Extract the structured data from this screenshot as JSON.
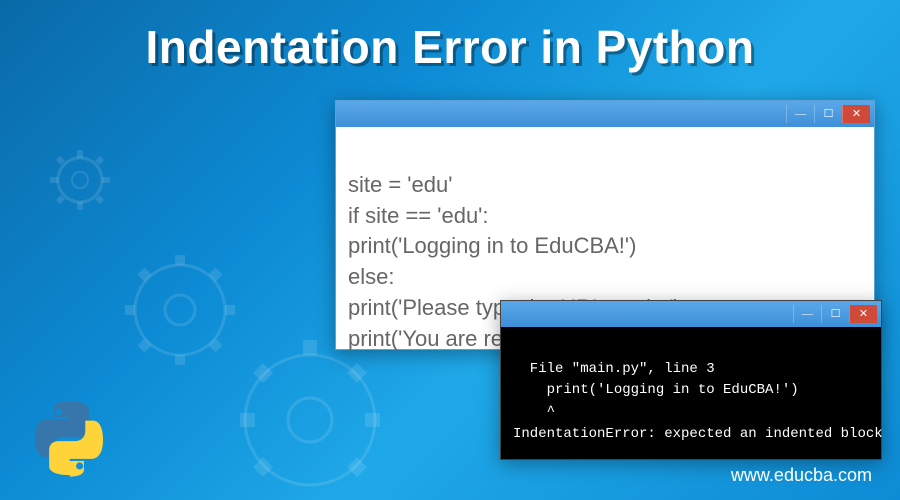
{
  "title": "Indentation Error in Python",
  "editor": {
    "lines": [
      "site = 'edu'",
      "if site == 'edu':",
      "print('Logging in to EduCBA!')",
      "else:",
      "print('Please type the URL again.')",
      "print('You are ready to go!')"
    ]
  },
  "terminal": {
    "lines": [
      "  File \"main.py\", line 3",
      "    print('Logging in to EduCBA!')",
      "    ^",
      "IndentationError: expected an indented block"
    ]
  },
  "window_controls": {
    "minimize": "—",
    "maximize": "☐",
    "close": "✕"
  },
  "site_url": "www.educba.com",
  "logo_name": "python-logo"
}
